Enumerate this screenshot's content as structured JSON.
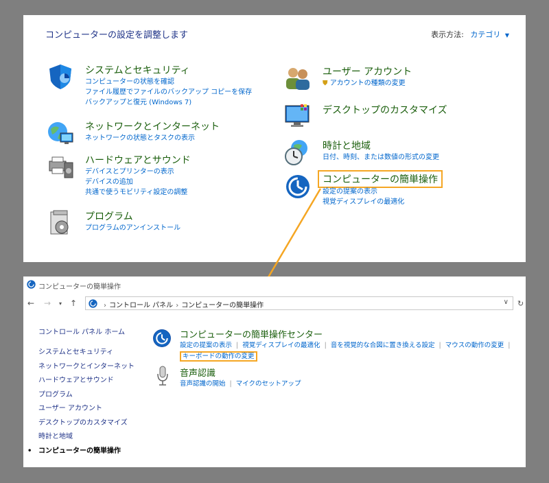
{
  "top": {
    "title": "コンピューターの設定を調整します",
    "view_by_label": "表示方法:",
    "view_by_value": "カテゴリ",
    "left_categories": [
      {
        "title": "システムとセキュリティ",
        "links": [
          "コンピューターの状態を確認",
          "ファイル履歴でファイルのバックアップ コピーを保存",
          "バックアップと復元 (Windows 7)"
        ]
      },
      {
        "title": "ネットワークとインターネット",
        "links": [
          "ネットワークの状態とタスクの表示"
        ]
      },
      {
        "title": "ハードウェアとサウンド",
        "links": [
          "デバイスとプリンターの表示",
          "デバイスの追加",
          "共通で使うモビリティ設定の調整"
        ]
      },
      {
        "title": "プログラム",
        "links": [
          "プログラムのアンインストール"
        ]
      }
    ],
    "right_categories": [
      {
        "title": "ユーザー アカウント",
        "links": [
          "アカウントの種類の変更"
        ]
      },
      {
        "title": "デスクトップのカスタマイズ",
        "links": []
      },
      {
        "title": "時計と地域",
        "links": [
          "日付、時刻、または数値の形式の変更"
        ]
      },
      {
        "title": "コンピューターの簡単操作",
        "links": [
          "設定の提案の表示",
          "視覚ディスプレイの最適化"
        ]
      }
    ]
  },
  "bottom": {
    "window_title": "コンピューターの簡単操作",
    "address": {
      "crumb1": "コントロール パネル",
      "crumb2": "コンピューターの簡単操作"
    },
    "sidebar": {
      "home": "コントロール パネル ホーム",
      "items": [
        "システムとセキュリティ",
        "ネットワークとインターネット",
        "ハードウェアとサウンド",
        "プログラム",
        "ユーザー アカウント",
        "デスクトップのカスタマイズ",
        "時計と地域",
        "コンピューターの簡単操作"
      ]
    },
    "ease_center": {
      "title": "コンピューターの簡単操作センター",
      "links": [
        "設定の提案の表示",
        "視覚ディスプレイの最適化",
        "音を視覚的な合図に置き換える設定",
        "マウスの動作の変更"
      ],
      "keyboard_link": "キーボードの動作の変更"
    },
    "speech": {
      "title": "音声認識",
      "links": [
        "音声認識の開始",
        "マイクのセットアップ"
      ]
    }
  },
  "colors": {
    "highlight": "#f5a623",
    "link": "#0066cc",
    "heading": "#1a5e0c"
  }
}
